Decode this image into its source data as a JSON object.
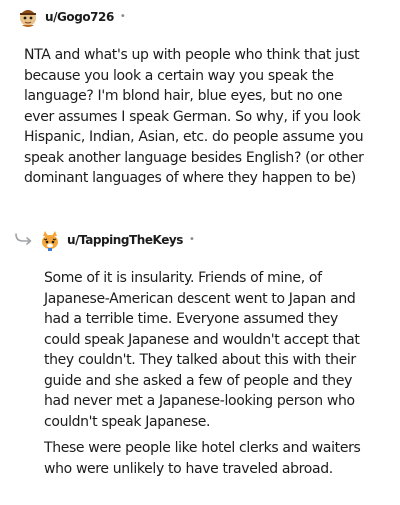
{
  "comments": [
    {
      "username": "u/Gogo726",
      "separator": "•",
      "avatar_icon": "snoo-avatar-icon",
      "paragraphs": [
        "NTA and what's up with people who think that just because you look a certain way you speak the language? I'm blond hair, blue eyes, but no one ever assumes I speak German. So why, if you look Hispanic, Indian, Asian, etc. do people assume you speak another language besides English? (or other dominant languages of where they happen to be)"
      ]
    },
    {
      "username": "u/TappingTheKeys",
      "separator": "•",
      "avatar_icon": "snoo-avatar-icon",
      "reply_icon": "reply-arrow-icon",
      "paragraphs": [
        "Some of it is insularity. Friends of mine, of Japanese-American descent went to Japan and had a terrible time. Everyone assumed they could speak Japanese and wouldn't accept that they couldn't. They talked about this with their guide and she asked a few of people and they had never met a Japanese-looking person who couldn't speak Japanese.",
        "These were people like hotel clerks and waiters who were unlikely to have traveled abroad."
      ]
    }
  ]
}
